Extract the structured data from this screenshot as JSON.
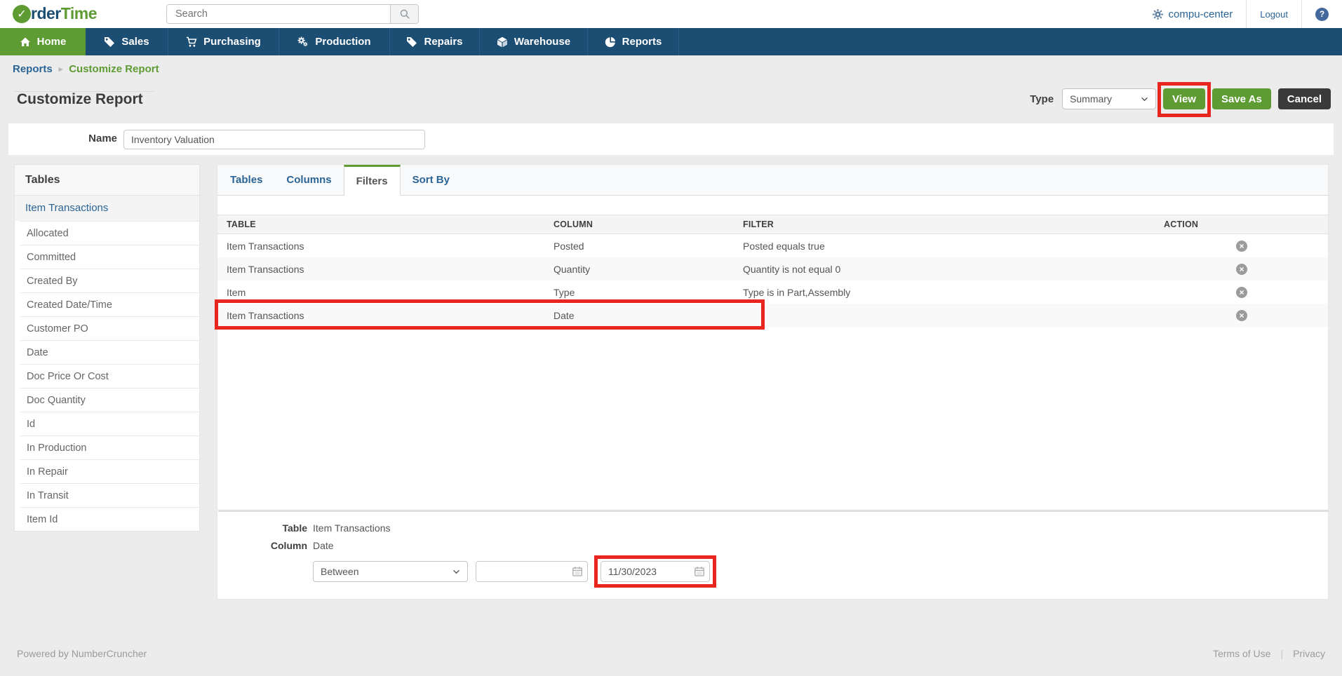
{
  "glyphs": {
    "check": "✓",
    "caret": "▸",
    "circle_x": "×",
    "pipe": "|",
    "help": "?"
  },
  "topbar": {
    "brand_blue": "rder",
    "brand_green": "Time",
    "search_placeholder": "Search",
    "account": "compu-center",
    "logout": "Logout"
  },
  "nav": [
    {
      "label": "Home"
    },
    {
      "label": "Sales"
    },
    {
      "label": "Purchasing"
    },
    {
      "label": "Production"
    },
    {
      "label": "Repairs"
    },
    {
      "label": "Warehouse"
    },
    {
      "label": "Reports"
    }
  ],
  "breadcrumb": {
    "parent": "Reports",
    "current": "Customize Report"
  },
  "header": {
    "title": "Customize Report",
    "type_label": "Type",
    "type_value": "Summary",
    "view": "View",
    "save_as": "Save As",
    "cancel": "Cancel",
    "name_label": "Name",
    "name_value": "Inventory Valuation"
  },
  "sidebar": {
    "title": "Tables",
    "selected": "Item Transactions",
    "items": [
      "Allocated",
      "Committed",
      "Created By",
      "Created Date/Time",
      "Customer PO",
      "Date",
      "Doc Price Or Cost",
      "Doc Quantity",
      "Id",
      "In Production",
      "In Repair",
      "In Transit",
      "Item Id"
    ]
  },
  "tabs": [
    {
      "label": "Tables"
    },
    {
      "label": "Columns"
    },
    {
      "label": "Filters"
    },
    {
      "label": "Sort By"
    }
  ],
  "filters": {
    "headers": {
      "table": "TABLE",
      "column": "COLUMN",
      "filter": "FILTER",
      "action": "ACTION"
    },
    "rows": [
      {
        "table": "Item Transactions",
        "column": "Posted",
        "filter": "Posted equals true"
      },
      {
        "table": "Item Transactions",
        "column": "Quantity",
        "filter": "Quantity is not equal 0"
      },
      {
        "table": "Item",
        "column": "Type",
        "filter": "Type is in Part,Assembly"
      },
      {
        "table": "Item Transactions",
        "column": "Date",
        "filter": ""
      }
    ]
  },
  "editor": {
    "table_label": "Table",
    "table_value": "Item Transactions",
    "column_label": "Column",
    "column_value": "Date",
    "operator": "Between",
    "date_from": "",
    "date_to": "11/30/2023"
  },
  "footer": {
    "powered": "Powered by NumberCruncher",
    "terms": "Terms of Use",
    "privacy": "Privacy"
  }
}
